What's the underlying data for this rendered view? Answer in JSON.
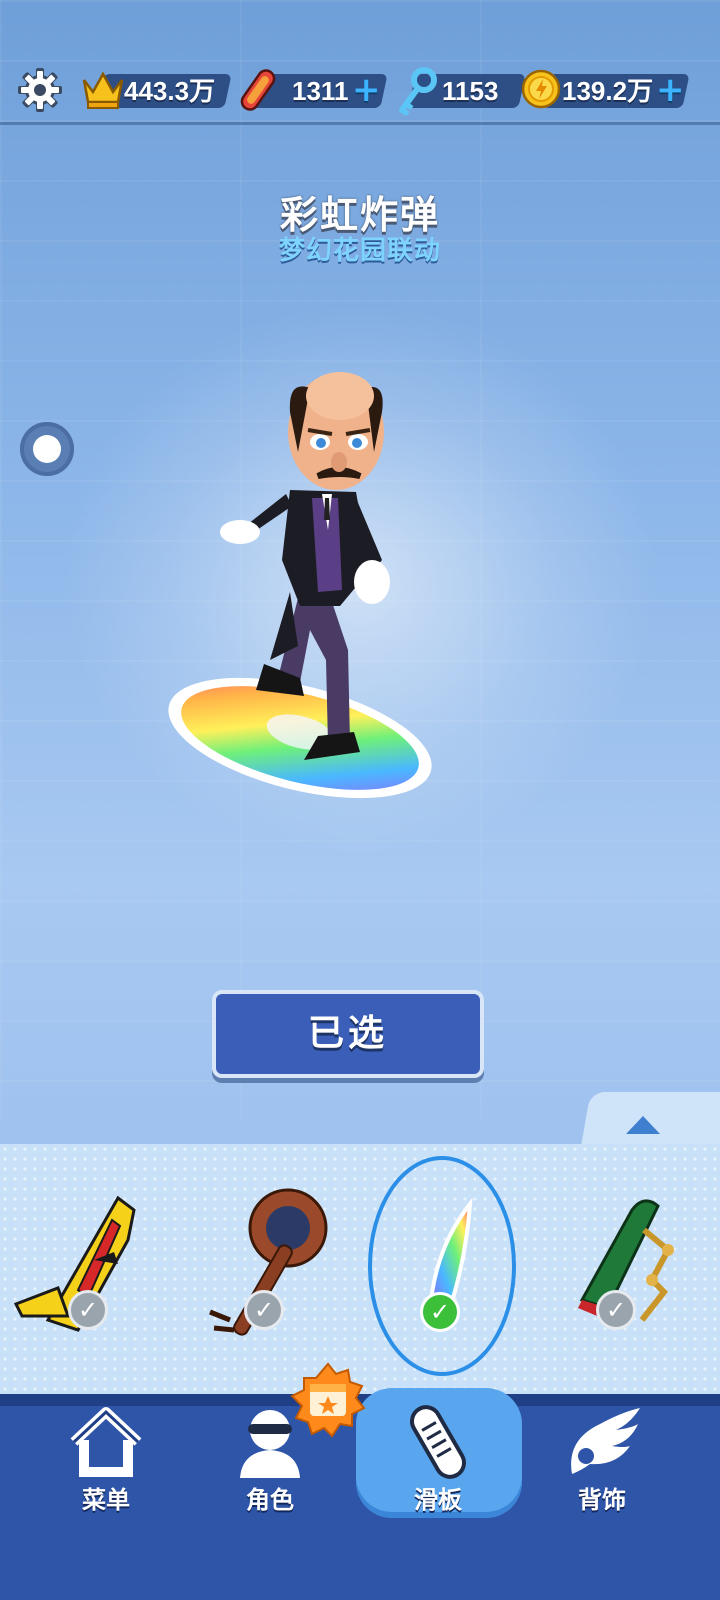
{
  "stats": {
    "trophy": "443.3万",
    "boards": "1311",
    "keys": "1153",
    "coins": "139.2万",
    "plus": "+"
  },
  "item": {
    "name": "彩虹炸弹",
    "collection": "梦幻花园联动"
  },
  "select_button": "已选",
  "carousel": {
    "selected_index": 2
  },
  "nav": {
    "menu": "菜单",
    "character": "角色",
    "board": "滑板",
    "upgrade": "背饰",
    "active": "board"
  },
  "colors": {
    "accent": "#3b5fb8",
    "check_green": "#3cc03a",
    "subtitle": "#7fd4ff"
  }
}
